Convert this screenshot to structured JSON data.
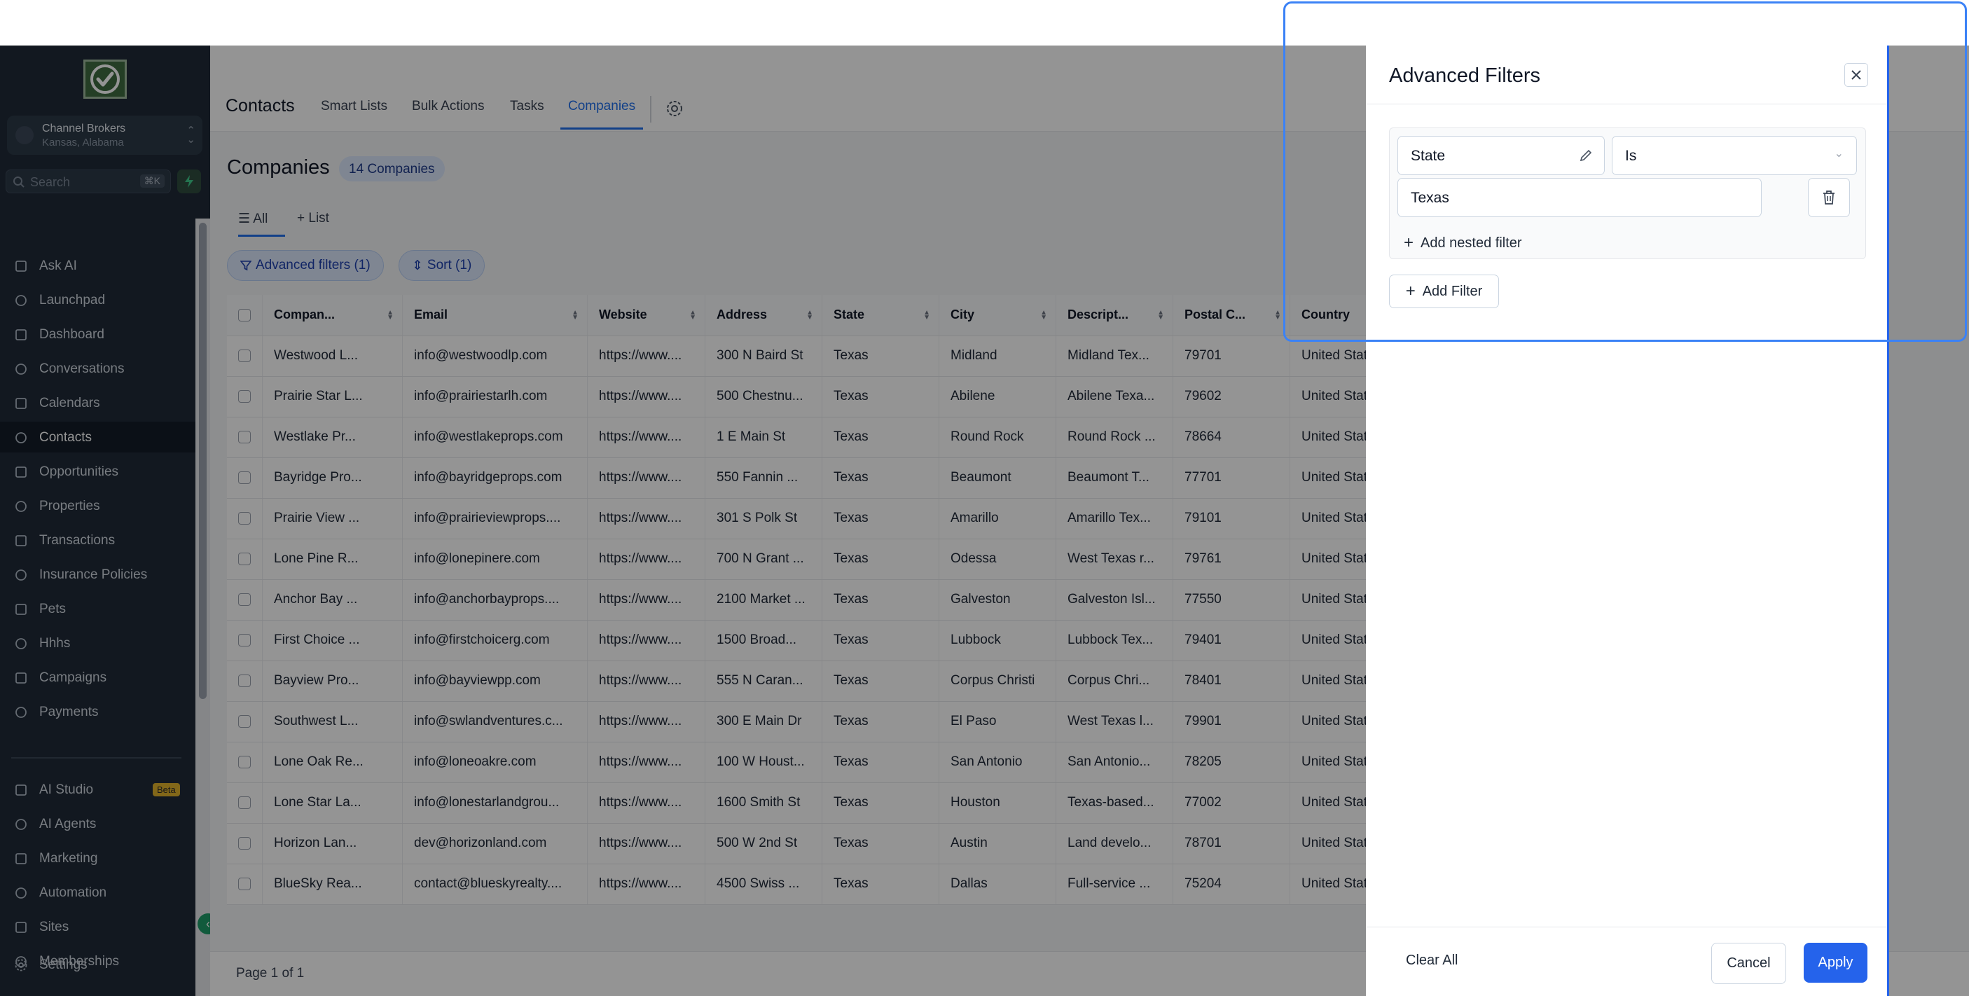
{
  "sidebar": {
    "account": {
      "name": "Channel Brokers",
      "location": "Kansas, Alabama"
    },
    "search": {
      "placeholder": "Search",
      "shortcut": "⌘K"
    },
    "items": [
      {
        "label": "Ask AI",
        "icon": "sparkle-icon"
      },
      {
        "label": "Launchpad",
        "icon": "rocket-icon"
      },
      {
        "label": "Dashboard",
        "icon": "grid-icon"
      },
      {
        "label": "Conversations",
        "icon": "chat-icon"
      },
      {
        "label": "Calendars",
        "icon": "calendar-icon"
      },
      {
        "label": "Contacts",
        "icon": "contacts-icon",
        "active": true
      },
      {
        "label": "Opportunities",
        "icon": "opportunities-icon"
      },
      {
        "label": "Properties",
        "icon": "building-icon"
      },
      {
        "label": "Transactions",
        "icon": "transactions-icon"
      },
      {
        "label": "Insurance Policies",
        "icon": "location-pin-icon"
      },
      {
        "label": "Pets",
        "icon": "paw-icon"
      },
      {
        "label": "Hhhs",
        "icon": "cube-icon"
      },
      {
        "label": "Campaigns",
        "icon": "campaigns-icon"
      },
      {
        "label": "Payments",
        "icon": "receipt-icon"
      }
    ],
    "items2": [
      {
        "label": "AI Studio",
        "icon": "ai-studio-icon",
        "badge": "Beta"
      },
      {
        "label": "AI Agents",
        "icon": "sparkle-icon"
      },
      {
        "label": "Marketing",
        "icon": "send-icon"
      },
      {
        "label": "Automation",
        "icon": "automation-icon"
      },
      {
        "label": "Sites",
        "icon": "sites-icon"
      },
      {
        "label": "Memberships",
        "icon": "membership-icon"
      }
    ],
    "settings": "Settings"
  },
  "header": {
    "title": "Contacts",
    "tabs": [
      "Smart Lists",
      "Bulk Actions",
      "Tasks",
      "Companies"
    ],
    "active_tab": "Companies"
  },
  "page": {
    "title": "Companies",
    "count_badge": "14 Companies",
    "views": [
      "All",
      "List"
    ],
    "advanced_filters": "Advanced filters (1)",
    "sort": "Sort (1)",
    "pager": "Page 1 of 1"
  },
  "table": {
    "columns": [
      "Compan...",
      "Email",
      "Website",
      "Address",
      "State",
      "City",
      "Descript...",
      "Postal C...",
      "Country"
    ],
    "rows": [
      [
        "Westwood L...",
        "info@westwoodlp.com",
        "https://www....",
        "300 N Baird St",
        "Texas",
        "Midland",
        "Midland Tex...",
        "79701",
        "United States"
      ],
      [
        "Prairie Star L...",
        "info@prairiestarlh.com",
        "https://www....",
        "500 Chestnu...",
        "Texas",
        "Abilene",
        "Abilene Texa...",
        "79602",
        "United States"
      ],
      [
        "Westlake Pr...",
        "info@westlakeprops.com",
        "https://www....",
        "1 E Main St",
        "Texas",
        "Round Rock",
        "Round Rock ...",
        "78664",
        "United States"
      ],
      [
        "Bayridge Pro...",
        "info@bayridgeprops.com",
        "https://www....",
        "550 Fannin ...",
        "Texas",
        "Beaumont",
        "Beaumont T...",
        "77701",
        "United States"
      ],
      [
        "Prairie View ...",
        "info@prairieviewprops....",
        "https://www....",
        "301 S Polk St",
        "Texas",
        "Amarillo",
        "Amarillo Tex...",
        "79101",
        "United States"
      ],
      [
        "Lone Pine R...",
        "info@lonepinere.com",
        "https://www....",
        "700 N Grant ...",
        "Texas",
        "Odessa",
        "West Texas r...",
        "79761",
        "United States"
      ],
      [
        "Anchor Bay ...",
        "info@anchorbayprops....",
        "https://www....",
        "2100 Market ...",
        "Texas",
        "Galveston",
        "Galveston Isl...",
        "77550",
        "United States"
      ],
      [
        "First Choice ...",
        "info@firstchoicerg.com",
        "https://www....",
        "1500 Broad...",
        "Texas",
        "Lubbock",
        "Lubbock Tex...",
        "79401",
        "United States"
      ],
      [
        "Bayview Pro...",
        "info@bayviewpp.com",
        "https://www....",
        "555 N Caran...",
        "Texas",
        "Corpus Christi",
        "Corpus Chri...",
        "78401",
        "United States"
      ],
      [
        "Southwest L...",
        "info@swlandventures.c...",
        "https://www....",
        "300 E Main Dr",
        "Texas",
        "El Paso",
        "West Texas l...",
        "79901",
        "United States"
      ],
      [
        "Lone Oak Re...",
        "info@loneoakre.com",
        "https://www....",
        "100 W Houst...",
        "Texas",
        "San Antonio",
        "San Antonio...",
        "78205",
        "United States"
      ],
      [
        "Lone Star La...",
        "info@lonestarlandgrou...",
        "https://www....",
        "1600 Smith St",
        "Texas",
        "Houston",
        "Texas-based...",
        "77002",
        "United States"
      ],
      [
        "Horizon Lan...",
        "dev@horizonland.com",
        "https://www....",
        "500 W 2nd St",
        "Texas",
        "Austin",
        "Land develo...",
        "78701",
        "United States"
      ],
      [
        "BlueSky Rea...",
        "contact@blueskyrealty....",
        "https://www....",
        "4500 Swiss ...",
        "Texas",
        "Dallas",
        "Full-service ...",
        "75204",
        "United States"
      ]
    ]
  },
  "panel": {
    "title": "Advanced Filters",
    "filter": {
      "field": "State",
      "operator": "Is",
      "value": "Texas"
    },
    "add_nested": "Add nested filter",
    "add_filter": "Add Filter",
    "clear_all": "Clear All",
    "cancel": "Cancel",
    "apply": "Apply"
  },
  "colors": {
    "accent": "#2563eb",
    "sidebar": "#1f2a37",
    "brand_green": "#1e9b68"
  }
}
